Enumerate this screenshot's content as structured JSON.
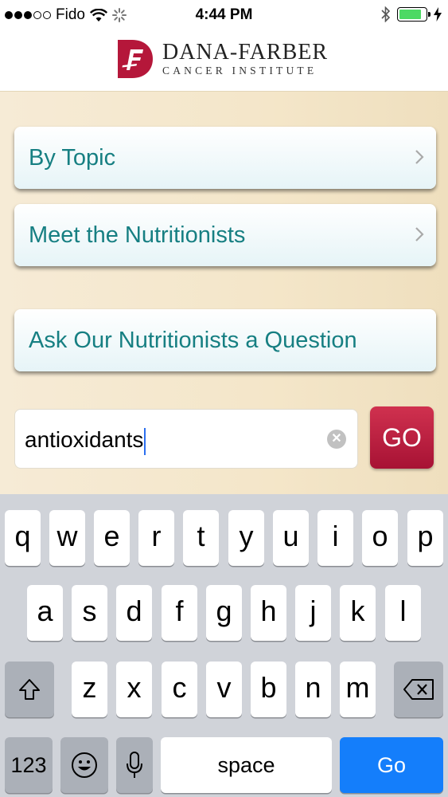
{
  "status_bar": {
    "carrier": "Fido",
    "time": "4:44 PM",
    "signal_dots_filled": 3,
    "signal_dots_total": 5,
    "battery_level": 0.85,
    "battery_color": "#4cd964",
    "icons": [
      "wifi-icon",
      "loading-spinner-icon",
      "bluetooth-icon",
      "battery-icon",
      "charging-bolt-icon"
    ]
  },
  "header": {
    "logo_line1": "DANA-FARBER",
    "logo_line2": "CANCER INSTITUTE",
    "brand_color": "#b5173a"
  },
  "menu": {
    "items": [
      {
        "label": "By Topic"
      },
      {
        "label": "Meet the Nutritionists"
      },
      {
        "label": "Ask Our Nutritionists a Question"
      }
    ],
    "text_color": "#167f82"
  },
  "search": {
    "value": "antioxidants",
    "go_label": "GO"
  },
  "keyboard": {
    "row1": [
      "q",
      "w",
      "e",
      "r",
      "t",
      "y",
      "u",
      "i",
      "o",
      "p"
    ],
    "row2": [
      "a",
      "s",
      "d",
      "f",
      "g",
      "h",
      "j",
      "k",
      "l"
    ],
    "row3": [
      "z",
      "x",
      "c",
      "v",
      "b",
      "n",
      "m"
    ],
    "numbers_label": "123",
    "space_label": "space",
    "go_label": "Go",
    "accent_color": "#147efb"
  }
}
